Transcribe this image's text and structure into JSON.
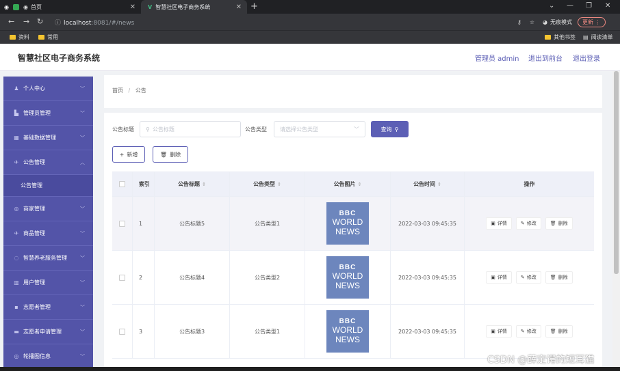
{
  "browser": {
    "tabs": [
      {
        "label": "首页"
      },
      {
        "label": "智慧社区电子商务系统"
      }
    ],
    "url_host": "localhost",
    "url_path": ":8081/#/news",
    "incognito_label": "无痕模式",
    "update_label": "更新",
    "bookmarks": [
      "资料",
      "常用"
    ],
    "bookmarks_right": [
      "其他书签",
      "阅读清单"
    ]
  },
  "app": {
    "title": "智慧社区电子商务系统",
    "header_links": {
      "admin": "管理员 admin",
      "to_front": "退出到前台",
      "logout": "退出登录"
    }
  },
  "sidebar": {
    "items": [
      {
        "label": "个人中心",
        "icon": "user-icon"
      },
      {
        "label": "管理员管理",
        "icon": "admin-icon"
      },
      {
        "label": "基础数据管理",
        "icon": "data-icon"
      },
      {
        "label": "公告管理",
        "icon": "announcement-icon",
        "expanded": true
      },
      {
        "label": "商家管理",
        "icon": "shop-icon"
      },
      {
        "label": "商品管理",
        "icon": "goods-icon"
      },
      {
        "label": "智慧养老服务管理",
        "icon": "elderly-icon"
      },
      {
        "label": "用户管理",
        "icon": "users-icon"
      },
      {
        "label": "志愿者管理",
        "icon": "volunteer-icon"
      },
      {
        "label": "志愿者申请管理",
        "icon": "apply-icon"
      },
      {
        "label": "轮播图信息",
        "icon": "carousel-icon"
      }
    ],
    "submenu": {
      "label": "公告管理"
    }
  },
  "breadcrumb": {
    "home": "首页",
    "sep": "/",
    "current": "公告"
  },
  "filters": {
    "title_label": "公告标题",
    "title_placeholder": "公告标题",
    "type_label": "公告类型",
    "type_placeholder": "请选择公告类型",
    "query_label": "查询"
  },
  "toolbar": {
    "add_label": "新增",
    "delete_label": "删除"
  },
  "table": {
    "headers": {
      "index": "索引",
      "title": "公告标题",
      "type": "公告类型",
      "image": "公告图片",
      "time": "公告时间",
      "actions": "操作"
    },
    "rows": [
      {
        "index": "1",
        "title": "公告标题5",
        "type": "公告类型1",
        "image_text": [
          "BBC",
          "WORLD",
          "NEWS"
        ],
        "time": "2022-03-03 09:45:35"
      },
      {
        "index": "2",
        "title": "公告标题4",
        "type": "公告类型2",
        "image_text": [
          "BBC",
          "WORLD",
          "NEWS"
        ],
        "time": "2022-03-03 09:45:35"
      },
      {
        "index": "3",
        "title": "公告标题3",
        "type": "公告类型1",
        "image_text": [
          "BBC",
          "WORLD",
          "NEWS"
        ],
        "time": "2022-03-03 09:45:35"
      }
    ],
    "actions": {
      "detail": "详情",
      "edit": "修改",
      "delete": "删除"
    }
  },
  "watermark": "CSDN @薛定谔的短耳猫",
  "colors": {
    "sidebar": "#5354a8",
    "accent": "#5c5fb5"
  }
}
